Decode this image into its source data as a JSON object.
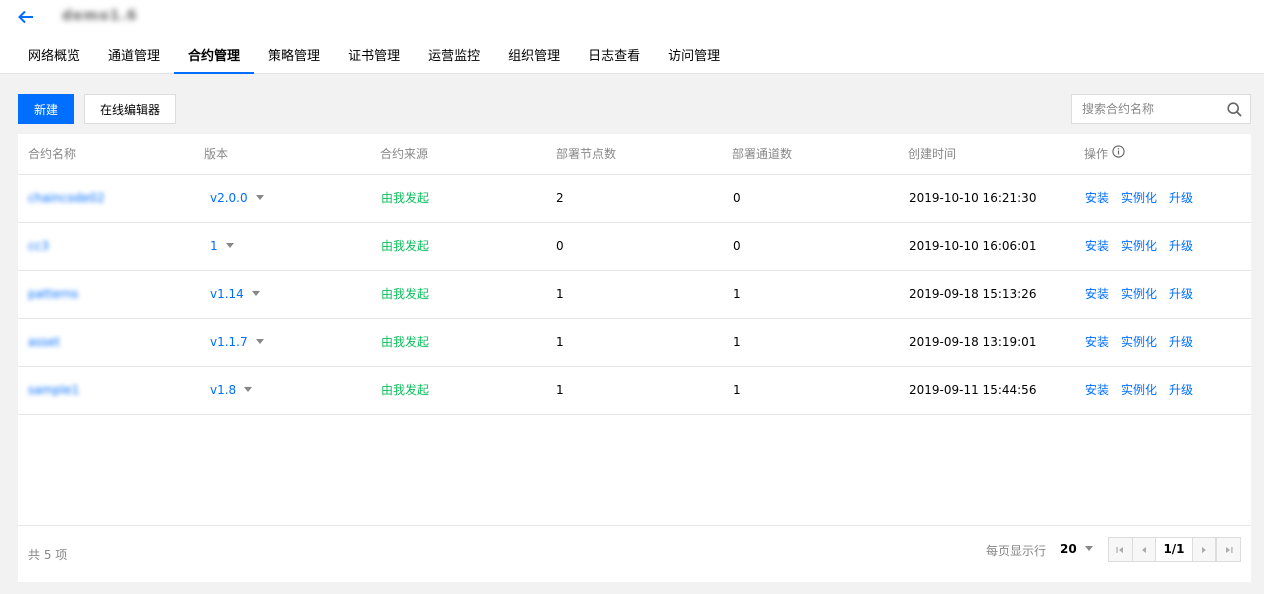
{
  "header": {
    "title": "demo1.6",
    "tabs": [
      "网络概览",
      "通道管理",
      "合约管理",
      "策略管理",
      "证书管理",
      "运营监控",
      "组织管理",
      "日志查看",
      "访问管理"
    ],
    "active_tab": "合约管理"
  },
  "toolbar": {
    "new_label": "新建",
    "editor_label": "在线编辑器",
    "search_placeholder": "搜索合约名称"
  },
  "table": {
    "columns": [
      "合约名称",
      "版本",
      "合约来源",
      "部署节点数",
      "部署通道数",
      "创建时间",
      "操作"
    ],
    "rows": [
      {
        "name": "chaincode02",
        "version": "v2.0.0",
        "source": "由我发起",
        "nodes": "2",
        "channels": "0",
        "created": "2019-10-10 16:21:30"
      },
      {
        "name": "cc3",
        "version": "1",
        "source": "由我发起",
        "nodes": "0",
        "channels": "0",
        "created": "2019-10-10 16:06:01"
      },
      {
        "name": "patterns",
        "version": "v1.14",
        "source": "由我发起",
        "nodes": "1",
        "channels": "1",
        "created": "2019-09-18 15:13:26"
      },
      {
        "name": "asset",
        "version": "v1.1.7",
        "source": "由我发起",
        "nodes": "1",
        "channels": "1",
        "created": "2019-09-18 13:19:01"
      },
      {
        "name": "sample1",
        "version": "v1.8",
        "source": "由我发起",
        "nodes": "1",
        "channels": "1",
        "created": "2019-09-11 15:44:56"
      }
    ],
    "actions": [
      "安装",
      "实例化",
      "升级"
    ]
  },
  "footer": {
    "total": "共 5 项",
    "per_page_label": "每页显示行",
    "per_page": "20",
    "page": "1/1"
  },
  "colors": {
    "accent": "#006eff",
    "success": "#0abf5b"
  }
}
